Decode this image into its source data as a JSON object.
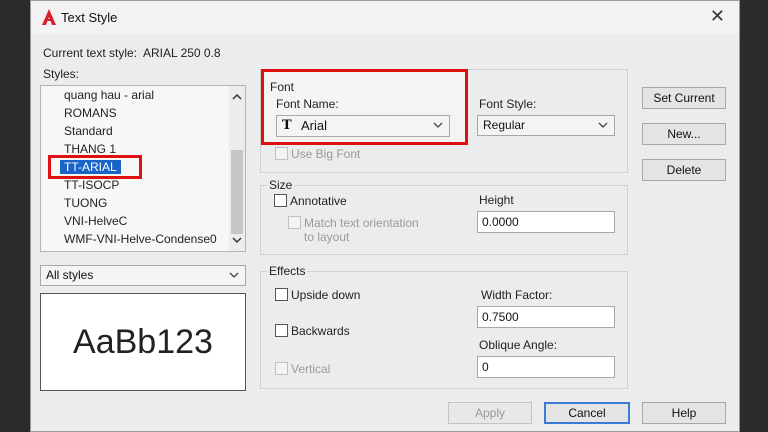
{
  "window": {
    "title": "Text Style",
    "app_icon": "autocad-logo-icon",
    "close_label": "✕"
  },
  "current_style": {
    "label": "Current text style:",
    "value": "ARIAL 250 0.8"
  },
  "styles": {
    "label": "Styles:",
    "items": [
      "quang hau - arial",
      "ROMANS",
      "Standard",
      "THANG 1",
      "TT-ARIAL",
      "TT-ISOCP",
      "TUONG",
      "VNI-HelveC",
      "WMF-VNI-Helve-Condense0"
    ],
    "selected": "TT-ARIAL"
  },
  "filter": {
    "value": "All styles"
  },
  "preview": {
    "text": "AaBb123"
  },
  "font": {
    "group_label": "Font",
    "name_label": "Font Name:",
    "name_value": "Arial",
    "style_label": "Font Style:",
    "style_value": "Regular",
    "big_font_label": "Use Big Font"
  },
  "size": {
    "group_label": "Size",
    "annotative_label": "Annotative",
    "match_label_1": "Match text orientation",
    "match_label_2": "to layout",
    "height_label": "Height",
    "height_value": "0.0000"
  },
  "effects": {
    "group_label": "Effects",
    "upside_down_label": "Upside down",
    "backwards_label": "Backwards",
    "vertical_label": "Vertical",
    "width_factor_label": "Width Factor:",
    "width_factor_value": "0.7500",
    "oblique_label": "Oblique Angle:",
    "oblique_value": "0"
  },
  "buttons": {
    "set_current": "Set Current",
    "new": "New...",
    "delete": "Delete",
    "apply": "Apply",
    "cancel": "Cancel",
    "help": "Help"
  },
  "colors": {
    "highlight": "#e01010",
    "selection": "#1a64c8"
  }
}
